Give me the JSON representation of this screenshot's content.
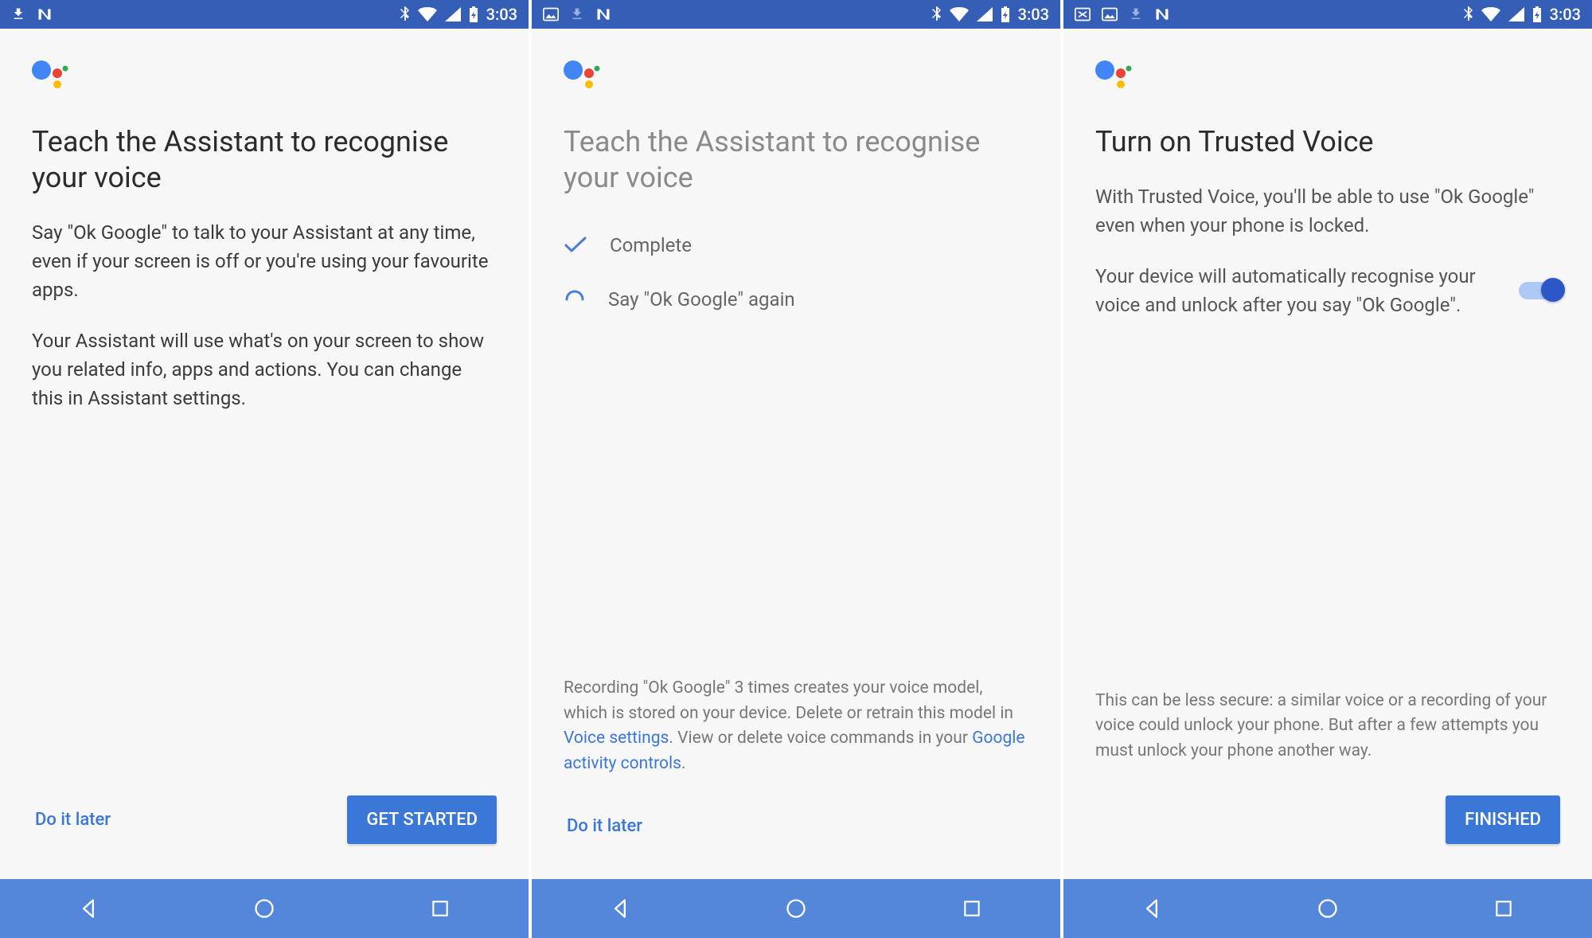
{
  "status": {
    "time": "3:03"
  },
  "screen1": {
    "heading": "Teach the Assistant to recognise your voice",
    "p1": "Say \"Ok Google\" to talk to your Assistant at any time, even if your screen is off or you're using your favourite apps.",
    "p2": "Your Assistant will use what's on your screen to show you related info, apps and actions. You can change this in Assistant settings.",
    "later": "Do it later",
    "cta": "GET STARTED"
  },
  "screen2": {
    "heading": "Teach the Assistant to recognise your voice",
    "step1": "Complete",
    "step2": "Say \"Ok Google\" again",
    "note_pre": "Recording \"Ok Google\" 3 times creates your voice model, which is stored on your device. Delete or retrain this model in ",
    "link1": "Voice settings",
    "note_mid": ". View or delete voice commands in your ",
    "link2": "Google activity controls",
    "note_post": ".",
    "later": "Do it later"
  },
  "screen3": {
    "heading": "Turn on Trusted Voice",
    "p1": "With Trusted Voice, you'll be able to use \"Ok Google\" even when your phone is locked.",
    "p2": "Your device will automatically recognise your voice and unlock after you say \"Ok Google\".",
    "note": "This can be less secure: a similar voice or a recording of your voice could unlock your phone. But after a few attempts you must unlock your phone another way.",
    "cta": "FINISHED"
  }
}
